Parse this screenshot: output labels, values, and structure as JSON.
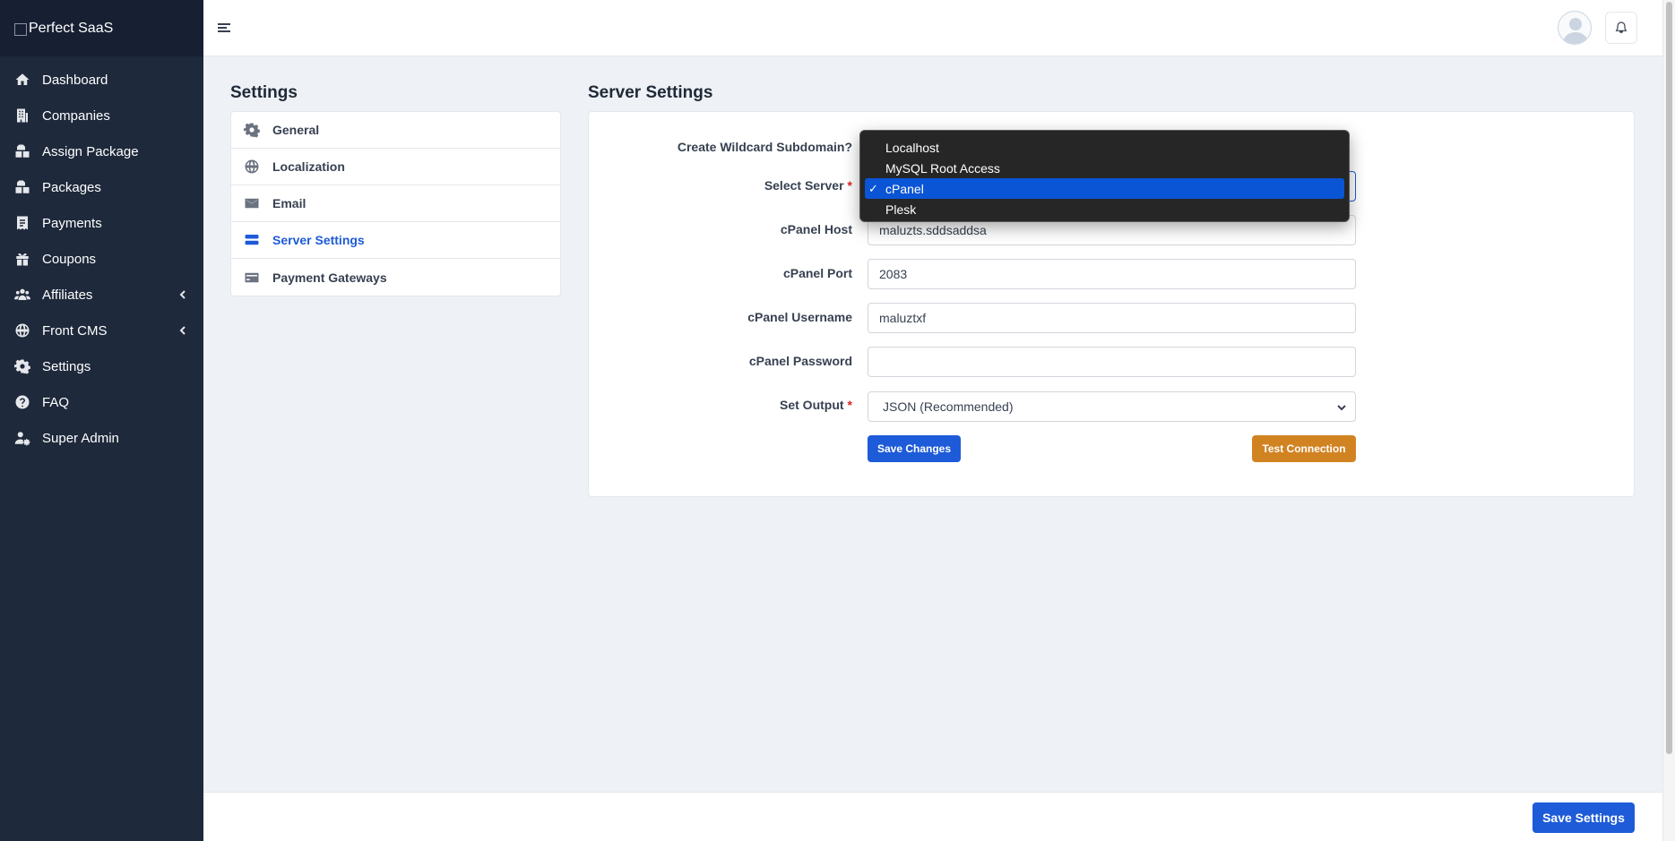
{
  "brand": {
    "alt_text": "Perfect SaaS"
  },
  "sidebar": {
    "items": [
      {
        "label": "Dashboard",
        "icon": "home-icon"
      },
      {
        "label": "Companies",
        "icon": "building-icon"
      },
      {
        "label": "Assign Package",
        "icon": "boxes-icon"
      },
      {
        "label": "Packages",
        "icon": "boxes-icon"
      },
      {
        "label": "Payments",
        "icon": "receipt-icon"
      },
      {
        "label": "Coupons",
        "icon": "gift-icon"
      },
      {
        "label": "Affiliates",
        "icon": "users-icon",
        "has_submenu": true
      },
      {
        "label": "Front CMS",
        "icon": "globe-icon",
        "has_submenu": true
      },
      {
        "label": "Settings",
        "icon": "gear-icon"
      },
      {
        "label": "FAQ",
        "icon": "question-circle-icon"
      },
      {
        "label": "Super Admin",
        "icon": "user-gear-icon"
      }
    ]
  },
  "settings": {
    "title": "Settings",
    "menu": [
      {
        "label": "General",
        "icon": "gear-icon"
      },
      {
        "label": "Localization",
        "icon": "globe-icon"
      },
      {
        "label": "Email",
        "icon": "envelope-icon"
      },
      {
        "label": "Server Settings",
        "icon": "server-icon",
        "active": true
      },
      {
        "label": "Payment Gateways",
        "icon": "credit-card-icon"
      }
    ]
  },
  "server": {
    "title": "Server Settings",
    "fields": {
      "wildcard_label": "Create Wildcard Subdomain?",
      "server_label": "Select Server",
      "host_label": "cPanel Host",
      "host_value": "maluzts.sddsaddsa",
      "port_label": "cPanel Port",
      "port_value": "2083",
      "username_label": "cPanel Username",
      "username_value": "maluztxf",
      "password_label": "cPanel Password",
      "password_value": "",
      "output_label": "Set Output",
      "output_value": "JSON (Recommended)"
    },
    "required_mark": "*",
    "save_changes": "Save Changes",
    "test_connection": "Test Connection",
    "server_options": [
      {
        "label": "Localhost"
      },
      {
        "label": "MySQL Root Access"
      },
      {
        "label": "cPanel",
        "selected": true
      },
      {
        "label": "Plesk"
      }
    ],
    "check_mark": "✓"
  },
  "footer": {
    "save_settings": "Save Settings"
  },
  "colors": {
    "sidebar_bg": "#1e293b",
    "primary": "#1d5bd8",
    "warning": "#d28321",
    "required": "#dc2626"
  }
}
